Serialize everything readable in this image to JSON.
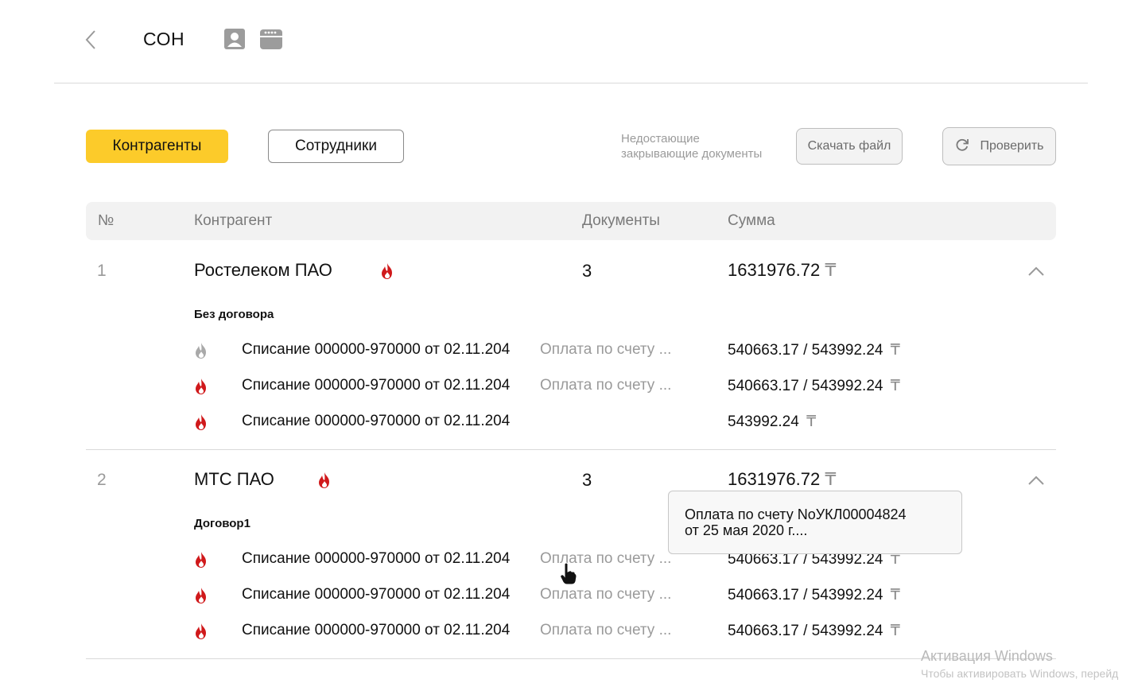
{
  "header": {
    "title": "СОН"
  },
  "tabs": {
    "counterparties": "Контрагенты",
    "employees": "Сотрудники"
  },
  "actions": {
    "missing_docs_label_line1": "Недостающие",
    "missing_docs_label_line2": "закрывающие документы",
    "download_label": "Скачать файл",
    "check_label": "Проверить"
  },
  "table": {
    "headers": {
      "num": "№",
      "counterparty": "Контрагент",
      "documents": "Документы",
      "sum": "Сумма"
    }
  },
  "currency_symbol": "₸",
  "colors": {
    "accent": "#fccb2a",
    "flame_active": "#d0191b",
    "flame_inactive": "#a9a9a9"
  },
  "groups": [
    {
      "num": "1",
      "name": "Ростелеком ПАО",
      "docs": "3",
      "sum": "1631976.72",
      "contract": "Без договора",
      "items": [
        {
          "title": "Списание 000000-970000 от 02.11.204",
          "desc": "Оплата по счету ...",
          "amount": "540663.17 / 543992.24",
          "flame": "inactive"
        },
        {
          "title": "Списание 000000-970000 от 02.11.204",
          "desc": "Оплата по счету ...",
          "amount": "540663.17 / 543992.24",
          "flame": "active"
        },
        {
          "title": "Списание 000000-970000 от 02.11.204",
          "desc": "",
          "amount": "543992.24",
          "flame": "active"
        }
      ]
    },
    {
      "num": "2",
      "name": "МТС ПАО",
      "docs": "3",
      "sum": "1631976.72",
      "contract": "Договор1",
      "items": [
        {
          "title": "Списание 000000-970000 от 02.11.204",
          "desc": "Оплата по счету ...",
          "amount": "540663.17 / 543992.24",
          "flame": "active"
        },
        {
          "title": "Списание 000000-970000 от 02.11.204",
          "desc": "Оплата по счету ...",
          "amount": "540663.17 / 543992.24",
          "flame": "active"
        },
        {
          "title": "Списание 000000-970000 от 02.11.204",
          "desc": "Оплата по счету ...",
          "amount": "540663.17 / 543992.24",
          "flame": "active"
        }
      ]
    }
  ],
  "tooltip": {
    "line1": "Оплата по счету NoУКЛ00004824",
    "line2": "от 25 мая 2020 г...."
  },
  "watermark": {
    "title": "Активация Windows",
    "subtitle": "Чтобы активировать Windows, перейд"
  }
}
